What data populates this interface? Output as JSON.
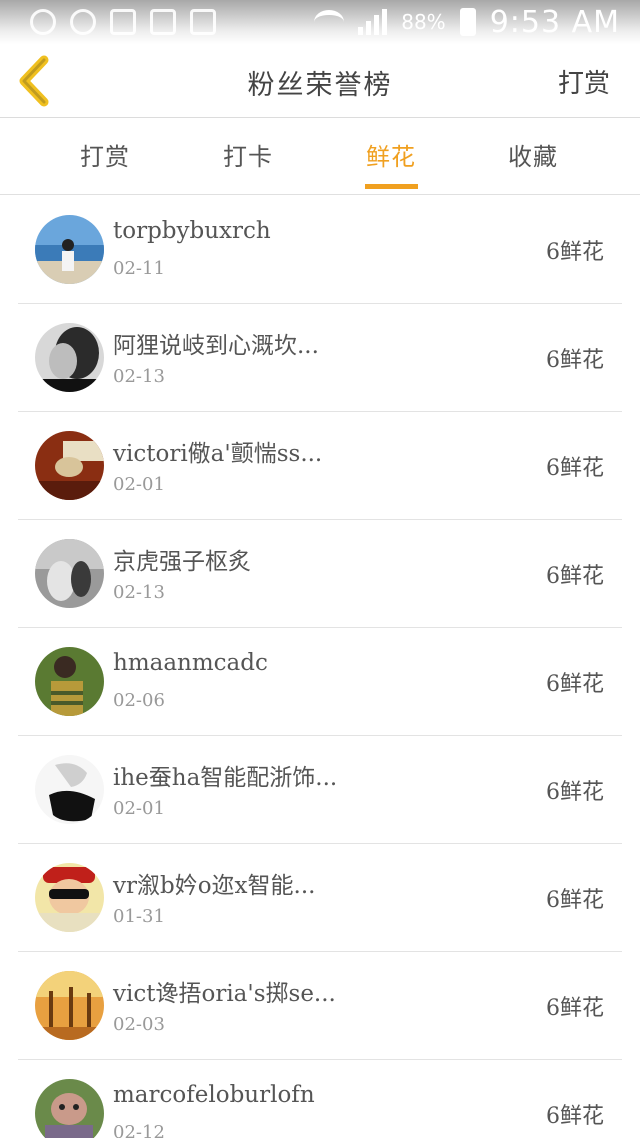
{
  "status_bar": {
    "battery": "88%",
    "time": "9:53 AM"
  },
  "header": {
    "title": "粉丝荣誉榜",
    "action": "打赏",
    "back_icon": "chevron-left-icon",
    "accent_color": "#f0a020"
  },
  "tabs": [
    {
      "label": "打赏",
      "active": false
    },
    {
      "label": "打卡",
      "active": false
    },
    {
      "label": "鲜花",
      "active": true
    },
    {
      "label": "收藏",
      "active": false
    }
  ],
  "list": [
    {
      "name": "torpbybuxrch",
      "date": "02-11",
      "count": "6鲜花"
    },
    {
      "name": "阿狸说岐到心溉坎...",
      "date": "02-13",
      "count": "6鲜花"
    },
    {
      "name": "victori儆a'颤惴ss...",
      "date": "02-01",
      "count": "6鲜花"
    },
    {
      "name": "京虎强子枢炙",
      "date": "02-13",
      "count": "6鲜花"
    },
    {
      "name": "hmaanmcadc",
      "date": "02-06",
      "count": "6鲜花"
    },
    {
      "name": "ihe蚕ha智能配浙饰...",
      "date": "02-01",
      "count": "6鲜花"
    },
    {
      "name": "vr溆b妗o迩x智能...",
      "date": "01-31",
      "count": "6鲜花"
    },
    {
      "name": "vict谗捂oria's掷se...",
      "date": "02-03",
      "count": "6鲜花"
    },
    {
      "name": "marcofeloburlofn",
      "date": "02-12",
      "count": "6鲜花"
    }
  ]
}
